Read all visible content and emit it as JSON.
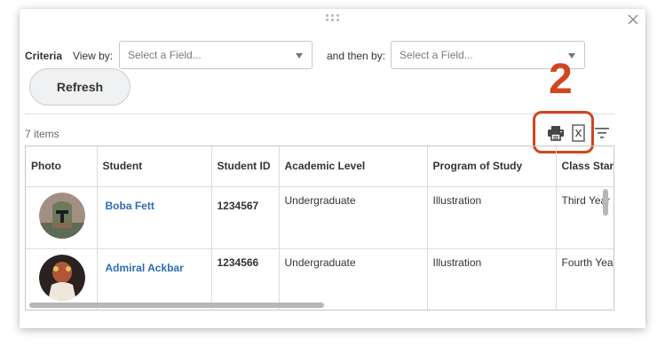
{
  "criteria": {
    "label": "Criteria",
    "view_by_label": "View by:",
    "view_by_placeholder": "Select a Field...",
    "then_by_label": "and then by:",
    "then_by_placeholder": "Select a Field..."
  },
  "refresh_label": "Refresh",
  "items_count": "7 items",
  "annotation_number": "2",
  "toolbar": {
    "print_icon": "printer-icon",
    "excel_icon": "excel-export-icon",
    "filter_icon": "filter-icon"
  },
  "grid": {
    "columns": [
      "Photo",
      "Student",
      "Student ID",
      "Academic Level",
      "Program of Study",
      "Class Standing"
    ],
    "rows": [
      {
        "student": "Boba Fett",
        "student_id": "1234567",
        "academic_level": "Undergraduate",
        "program": "Illustration",
        "class_standing": "Third Year"
      },
      {
        "student": "Admiral Ackbar",
        "student_id": "1234566",
        "academic_level": "Undergraduate",
        "program": "Illustration",
        "class_standing": "Fourth Year"
      }
    ]
  },
  "colors": {
    "annotation": "#d1451f",
    "link": "#2e6cb5"
  }
}
